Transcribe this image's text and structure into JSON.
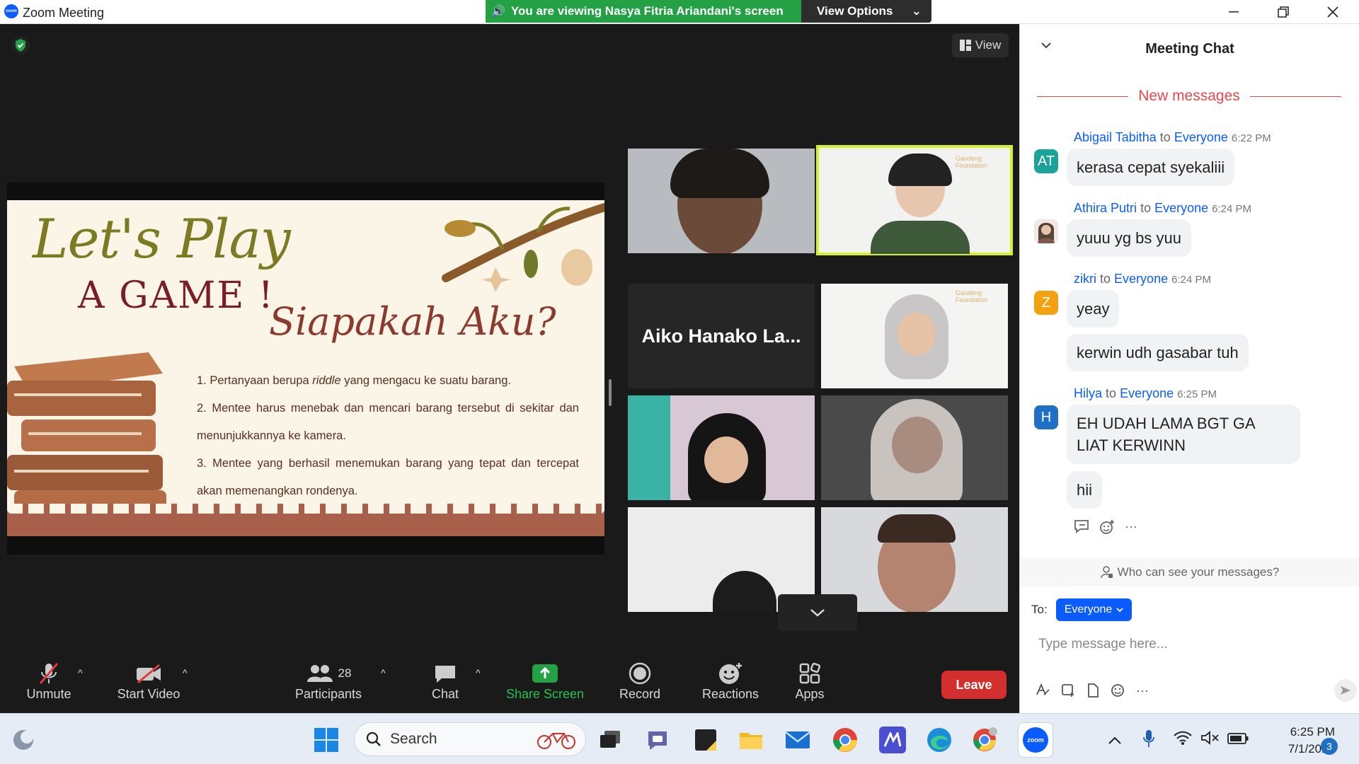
{
  "window": {
    "app_title": "Zoom Meeting",
    "app_logo_text": "zoom",
    "viewing_banner": "You are viewing Nasya Fitria Ariandani's screen",
    "view_options_label": "View Options"
  },
  "meeting": {
    "view_button_label": "View",
    "slide": {
      "title_line1": "Let's Play",
      "title_line2": "A GAME !",
      "subtitle": "Siapakah Aku?",
      "rule1_prefix": "1. Pertanyaan berupa ",
      "rule1_italic": "riddle",
      "rule1_suffix": " yang mengacu ke suatu barang.",
      "rule2": "2. Mentee harus menebak dan mencari barang tersebut di sekitar dan menunjukkannya ke kamera.",
      "rule3": "3. Mentee yang berhasil menemukan barang yang tepat dan tercepat akan memenangkan rondenya."
    },
    "participant_tiles": [
      {
        "name": "Aiko Hanako La..."
      }
    ],
    "tile_logo_text": "Gandeng Foundation"
  },
  "toolbar": {
    "unmute": "Unmute",
    "start_video": "Start Video",
    "participants": "Participants",
    "participants_count": "28",
    "chat": "Chat",
    "share_screen": "Share Screen",
    "record": "Record",
    "reactions": "Reactions",
    "apps": "Apps",
    "leave": "Leave"
  },
  "chat": {
    "title": "Meeting Chat",
    "new_messages": "New messages",
    "recipient_word": "to",
    "messages": [
      {
        "sender": "Abigail Tabitha",
        "to": "Everyone",
        "time": "6:22 PM",
        "avatar": "AT",
        "avatar_color": "#1aa39a",
        "texts": [
          "kerasa cepat syekaliii"
        ]
      },
      {
        "sender": "Athira Putri",
        "to": "Everyone",
        "time": "6:24 PM",
        "avatar": "",
        "avatar_color": "#c9a38f",
        "texts": [
          "yuuu yg bs yuu"
        ]
      },
      {
        "sender": "zikri",
        "to": "Everyone",
        "time": "6:24 PM",
        "avatar": "Z",
        "avatar_color": "#f2a20f",
        "texts": [
          "yeay",
          "kerwin udh gasabar tuh"
        ]
      },
      {
        "sender": "Hilya",
        "to": "Everyone",
        "time": "6:25 PM",
        "avatar": "H",
        "avatar_color": "#1f6fc4",
        "texts": [
          "EH UDAH LAMA BGT GA LIAT KERWINN",
          "hii"
        ]
      }
    ],
    "who_can_see": "Who can see your messages?",
    "to_label": "To:",
    "to_value": "Everyone",
    "input_placeholder": "Type message here..."
  },
  "taskbar": {
    "search_placeholder": "Search",
    "time": "6:25 PM",
    "date": "7/1/2023",
    "notification_count": "3"
  },
  "colors": {
    "zoom_blue": "#0b5cff",
    "share_green": "#23a144",
    "leave_red": "#d32f2f",
    "new_messages_red": "#e8474c",
    "active_speaker": "#d7f02c"
  }
}
